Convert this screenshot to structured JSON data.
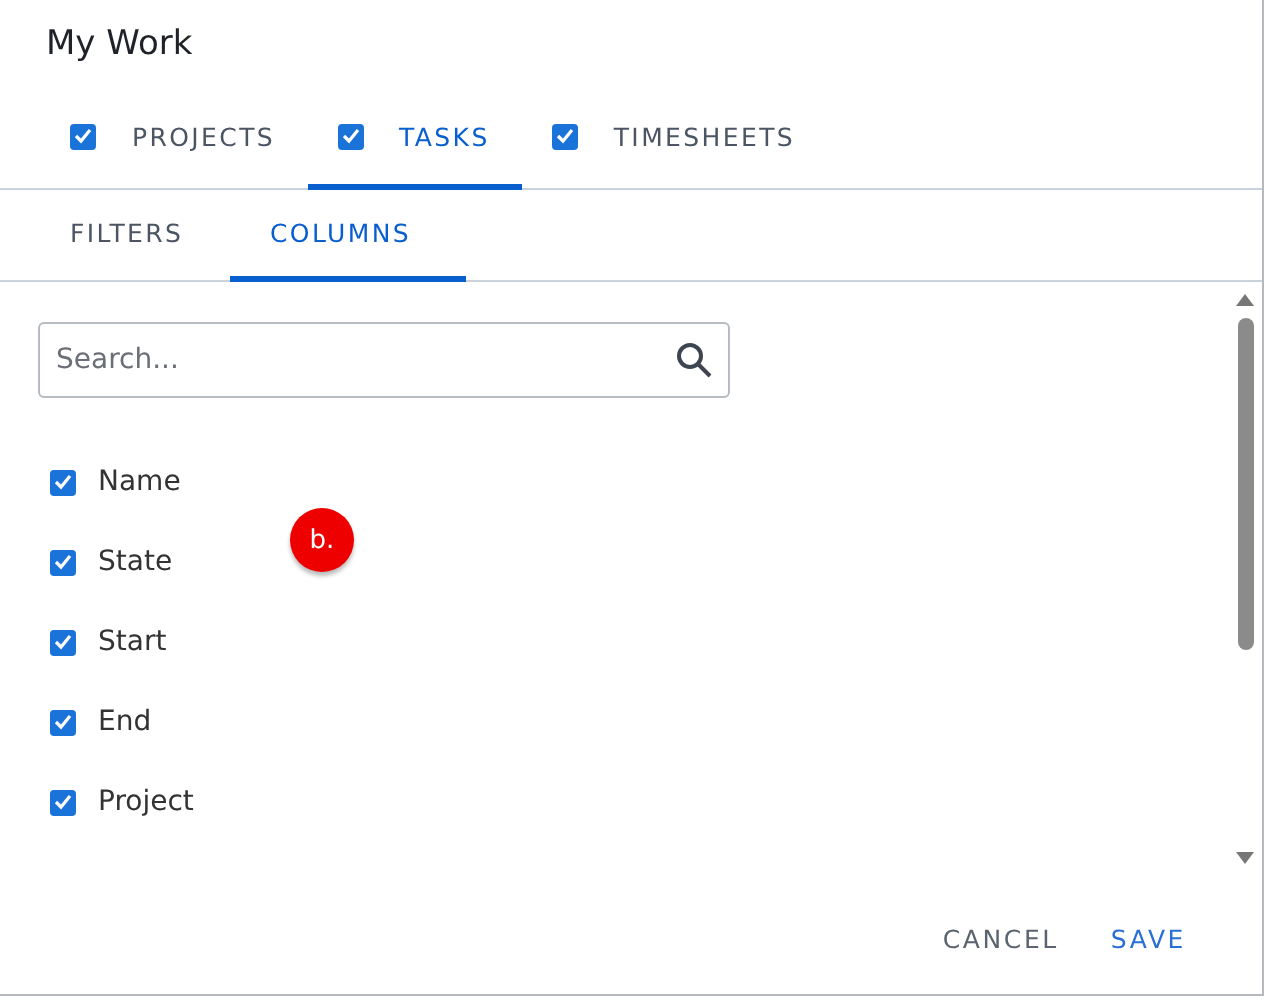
{
  "window": {
    "title": "My Work"
  },
  "tabs": [
    {
      "label": "PROJECTS",
      "checked": true,
      "selected": false
    },
    {
      "label": "TASKS",
      "checked": true,
      "selected": true
    },
    {
      "label": "TIMESHEETS",
      "checked": true,
      "selected": false
    }
  ],
  "subtabs": [
    {
      "label": "FILTERS",
      "selected": false
    },
    {
      "label": "COLUMNS",
      "selected": true
    }
  ],
  "search": {
    "placeholder": "Search..."
  },
  "columns": [
    {
      "label": "Name",
      "checked": true
    },
    {
      "label": "State",
      "checked": true
    },
    {
      "label": "Start",
      "checked": true
    },
    {
      "label": "End",
      "checked": true
    },
    {
      "label": "Project",
      "checked": true
    }
  ],
  "badge": "b.",
  "buttons": [
    {
      "label": "CANCEL",
      "kind": "secondary"
    },
    {
      "label": "SAVE",
      "kind": "primary"
    }
  ]
}
